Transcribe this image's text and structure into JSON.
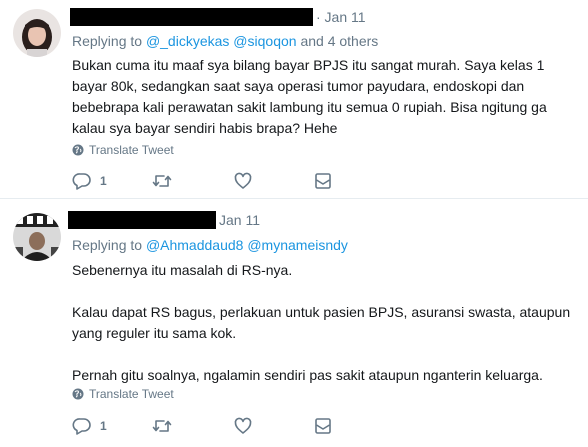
{
  "tweets": [
    {
      "date": "· Jan 11",
      "replying_prefix": "Replying to ",
      "mentions": [
        "@_dickyekas",
        "@siqoqon"
      ],
      "replying_suffix": " and 4 others",
      "paragraphs": [
        "Bukan cuma itu maaf sya bilang bayar BPJS itu sangat murah. Saya kelas 1 bayar 80k, sedangkan saat saya operasi tumor payudara, endoskopi dan bebebrapa kali perawatan sakit lambung itu semua 0 rupiah. Bisa ngitung ga kalau sya bayar sendiri habis brapa? Hehe"
      ],
      "translate_label": "Translate Tweet",
      "reply_count": "1",
      "retweet_count": "",
      "like_count": ""
    },
    {
      "date": "Jan 11",
      "replying_prefix": "Replying to ",
      "mentions": [
        "@Ahmaddaud8",
        "@mynameisndy"
      ],
      "replying_suffix": "",
      "paragraphs": [
        "Sebenernya itu masalah di RS-nya.",
        "Kalau dapat RS bagus, perlakuan untuk pasien BPJS, asuransi swasta, ataupun yang reguler itu sama kok.",
        "Pernah gitu soalnya, ngalamin sendiri pas sakit ataupun nganterin keluarga."
      ],
      "translate_label": "Translate Tweet",
      "reply_count": "1",
      "retweet_count": "",
      "like_count": ""
    }
  ],
  "icons": {
    "globe": "globe-icon",
    "reply": "reply-icon",
    "retweet": "retweet-icon",
    "like": "heart-icon",
    "dm": "envelope-icon"
  },
  "colors": {
    "link": "#1b95e0",
    "muted": "#657786",
    "text": "#14171a",
    "divider": "#e6ecf0"
  }
}
